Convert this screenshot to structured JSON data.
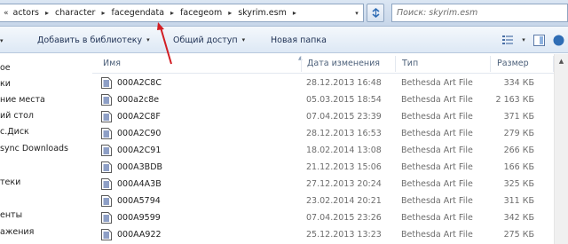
{
  "address_bar": {
    "overflow_glyph": "«",
    "path": [
      "actors",
      "character",
      "facegendata",
      "facegeom",
      "skyrim.esm"
    ],
    "separator_glyph": "▸",
    "dropdown_glyph": "▾"
  },
  "search": {
    "placeholder": "Поиск: skyrim.esm"
  },
  "toolbar": {
    "left_arrow": "▾",
    "add_to_library": "Добавить в библиотеку",
    "share": "Общий доступ",
    "new_folder": "Новая папка",
    "arrow": "▾"
  },
  "nav": {
    "items": [
      "ое",
      "ки",
      "ние места",
      "ий стол",
      "с.Диск",
      "sync Downloads",
      "",
      "теки",
      "",
      "енты",
      "ажения"
    ]
  },
  "columns": {
    "name": "Имя",
    "date": "Дата изменения",
    "type": "Тип",
    "size": "Размер"
  },
  "files": [
    {
      "name": "000A2C8C",
      "date": "28.12.2013 16:48",
      "type": "Bethesda Art File",
      "size": "334 КБ"
    },
    {
      "name": "000a2c8e",
      "date": "05.03.2015 18:54",
      "type": "Bethesda Art File",
      "size": "2 163 КБ"
    },
    {
      "name": "000A2C8F",
      "date": "07.04.2015 23:39",
      "type": "Bethesda Art File",
      "size": "371 КБ"
    },
    {
      "name": "000A2C90",
      "date": "28.12.2013 16:53",
      "type": "Bethesda Art File",
      "size": "279 КБ"
    },
    {
      "name": "000A2C91",
      "date": "18.02.2014 13:08",
      "type": "Bethesda Art File",
      "size": "266 КБ"
    },
    {
      "name": "000A3BDB",
      "date": "21.12.2013 15:06",
      "type": "Bethesda Art File",
      "size": "166 КБ"
    },
    {
      "name": "000A4A3B",
      "date": "27.12.2013 20:24",
      "type": "Bethesda Art File",
      "size": "325 КБ"
    },
    {
      "name": "000A5794",
      "date": "23.02.2014 20:21",
      "type": "Bethesda Art File",
      "size": "311 КБ"
    },
    {
      "name": "000A9599",
      "date": "07.04.2015 23:26",
      "type": "Bethesda Art File",
      "size": "342 КБ"
    },
    {
      "name": "000AA922",
      "date": "25.12.2013 13:23",
      "type": "Bethesda Art File",
      "size": "275 КБ"
    }
  ],
  "colors": {
    "annotation_arrow": "#d21e24",
    "header_text": "#4c607a",
    "dim_text": "#6d6d6d"
  }
}
